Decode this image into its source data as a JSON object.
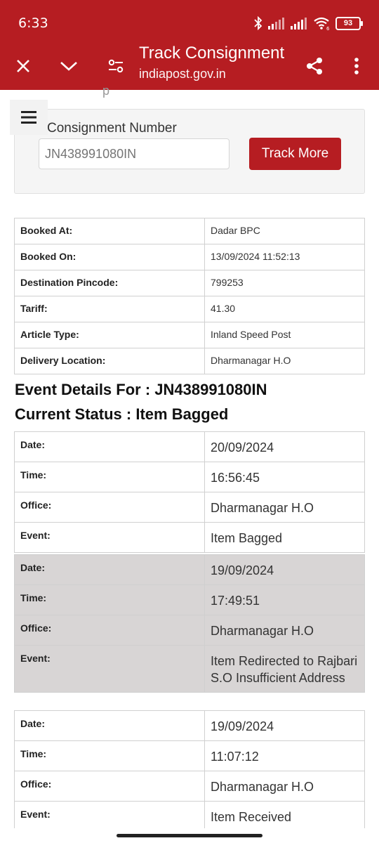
{
  "status": {
    "time": "6:33",
    "battery": "93",
    "wifi_badge": "6"
  },
  "appbar": {
    "title": "Track Consignment",
    "subtitle": "indiapost.gov.in"
  },
  "page": {
    "clipped_title": "p"
  },
  "search": {
    "label": "Consignment Number",
    "placeholder": "JN438991080IN",
    "button_label": "Track More"
  },
  "booking": [
    {
      "key": "Booked At:",
      "value": "Dadar BPC"
    },
    {
      "key": "Booked On:",
      "value": "13/09/2024 11:52:13"
    },
    {
      "key": "Destination Pincode:",
      "value": "799253"
    },
    {
      "key": "Tariff:",
      "value": "41.30"
    },
    {
      "key": "Article Type:",
      "value": "Inland Speed Post"
    },
    {
      "key": "Delivery Location:",
      "value": "Dharmanagar H.O"
    }
  ],
  "event_heading": "Event Details For : JN438991080IN",
  "status_heading": "Current Status : Item Bagged",
  "labels": {
    "date": "Date:",
    "time": "Time:",
    "office": "Office:",
    "event": "Event:"
  },
  "events": [
    {
      "date": "20/09/2024",
      "time": "16:56:45",
      "office": "Dharmanagar H.O",
      "event": "Item Bagged"
    },
    {
      "date": "19/09/2024",
      "time": "17:49:51",
      "office": "Dharmanagar H.O",
      "event": "Item Redirected to Rajbari S.O Insufficient Address"
    },
    {
      "date": "19/09/2024",
      "time": "11:07:12",
      "office": "Dharmanagar H.O",
      "event": "Item Received"
    }
  ]
}
